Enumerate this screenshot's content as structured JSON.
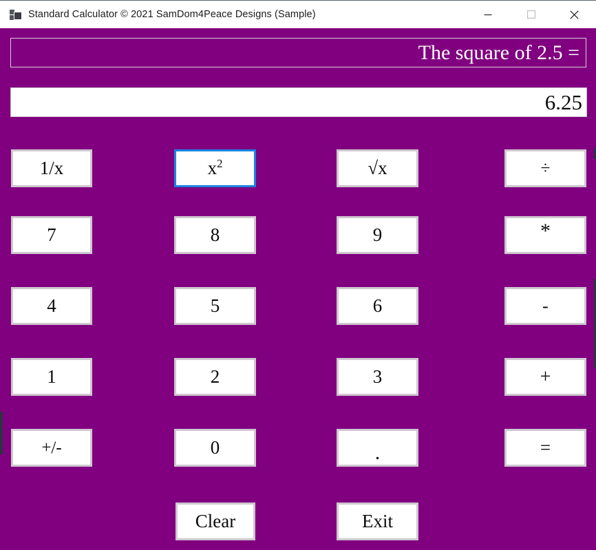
{
  "window": {
    "title": "Standard Calculator © 2021 SamDom4Peace Designs (Sample)",
    "icon": "app-windows-forms-icon",
    "controls": {
      "minimize": "minimize-icon",
      "maximize": "maximize-icon",
      "close": "close-icon"
    },
    "colors": {
      "background": "#800080",
      "titlebar": "#ffffff",
      "button_face": "#ffffff",
      "button_border": "#cfc8cf",
      "focus_border": "#1884e0",
      "label_text": "#ffffff",
      "value_text": "#0b0b0b"
    }
  },
  "expression": {
    "text": "The square of 2.5 ="
  },
  "display": {
    "value": "6.25",
    "placeholder": "0"
  },
  "keypad": {
    "rows": [
      [
        {
          "label": "1/x",
          "name": "reciprocal-button",
          "focused": false
        },
        {
          "label": "x²",
          "name": "square-button",
          "focused": true
        },
        {
          "label": "√x",
          "name": "square-root-button",
          "focused": false
        },
        {
          "label": "÷",
          "name": "divide-button",
          "focused": false
        }
      ],
      [
        {
          "label": "7",
          "name": "digit-7-button",
          "focused": false
        },
        {
          "label": "8",
          "name": "digit-8-button",
          "focused": false
        },
        {
          "label": "9",
          "name": "digit-9-button",
          "focused": false
        },
        {
          "label": "*",
          "name": "multiply-button",
          "focused": false
        }
      ],
      [
        {
          "label": "4",
          "name": "digit-4-button",
          "focused": false
        },
        {
          "label": "5",
          "name": "digit-5-button",
          "focused": false
        },
        {
          "label": "6",
          "name": "digit-6-button",
          "focused": false
        },
        {
          "label": "-",
          "name": "subtract-button",
          "focused": false
        }
      ],
      [
        {
          "label": "1",
          "name": "digit-1-button",
          "focused": false
        },
        {
          "label": "2",
          "name": "digit-2-button",
          "focused": false
        },
        {
          "label": "3",
          "name": "digit-3-button",
          "focused": false
        },
        {
          "label": "+",
          "name": "add-button",
          "focused": false
        }
      ],
      [
        {
          "label": "+/-",
          "name": "sign-toggle-button",
          "focused": false
        },
        {
          "label": "0",
          "name": "digit-0-button",
          "focused": false
        },
        {
          "label": ".",
          "name": "decimal-point-button",
          "focused": false
        },
        {
          "label": "=",
          "name": "equals-button",
          "focused": false
        }
      ]
    ],
    "bottom": [
      {
        "label": "Clear",
        "name": "clear-button",
        "focused": false
      },
      {
        "label": "Exit",
        "name": "exit-button",
        "focused": false
      }
    ]
  }
}
